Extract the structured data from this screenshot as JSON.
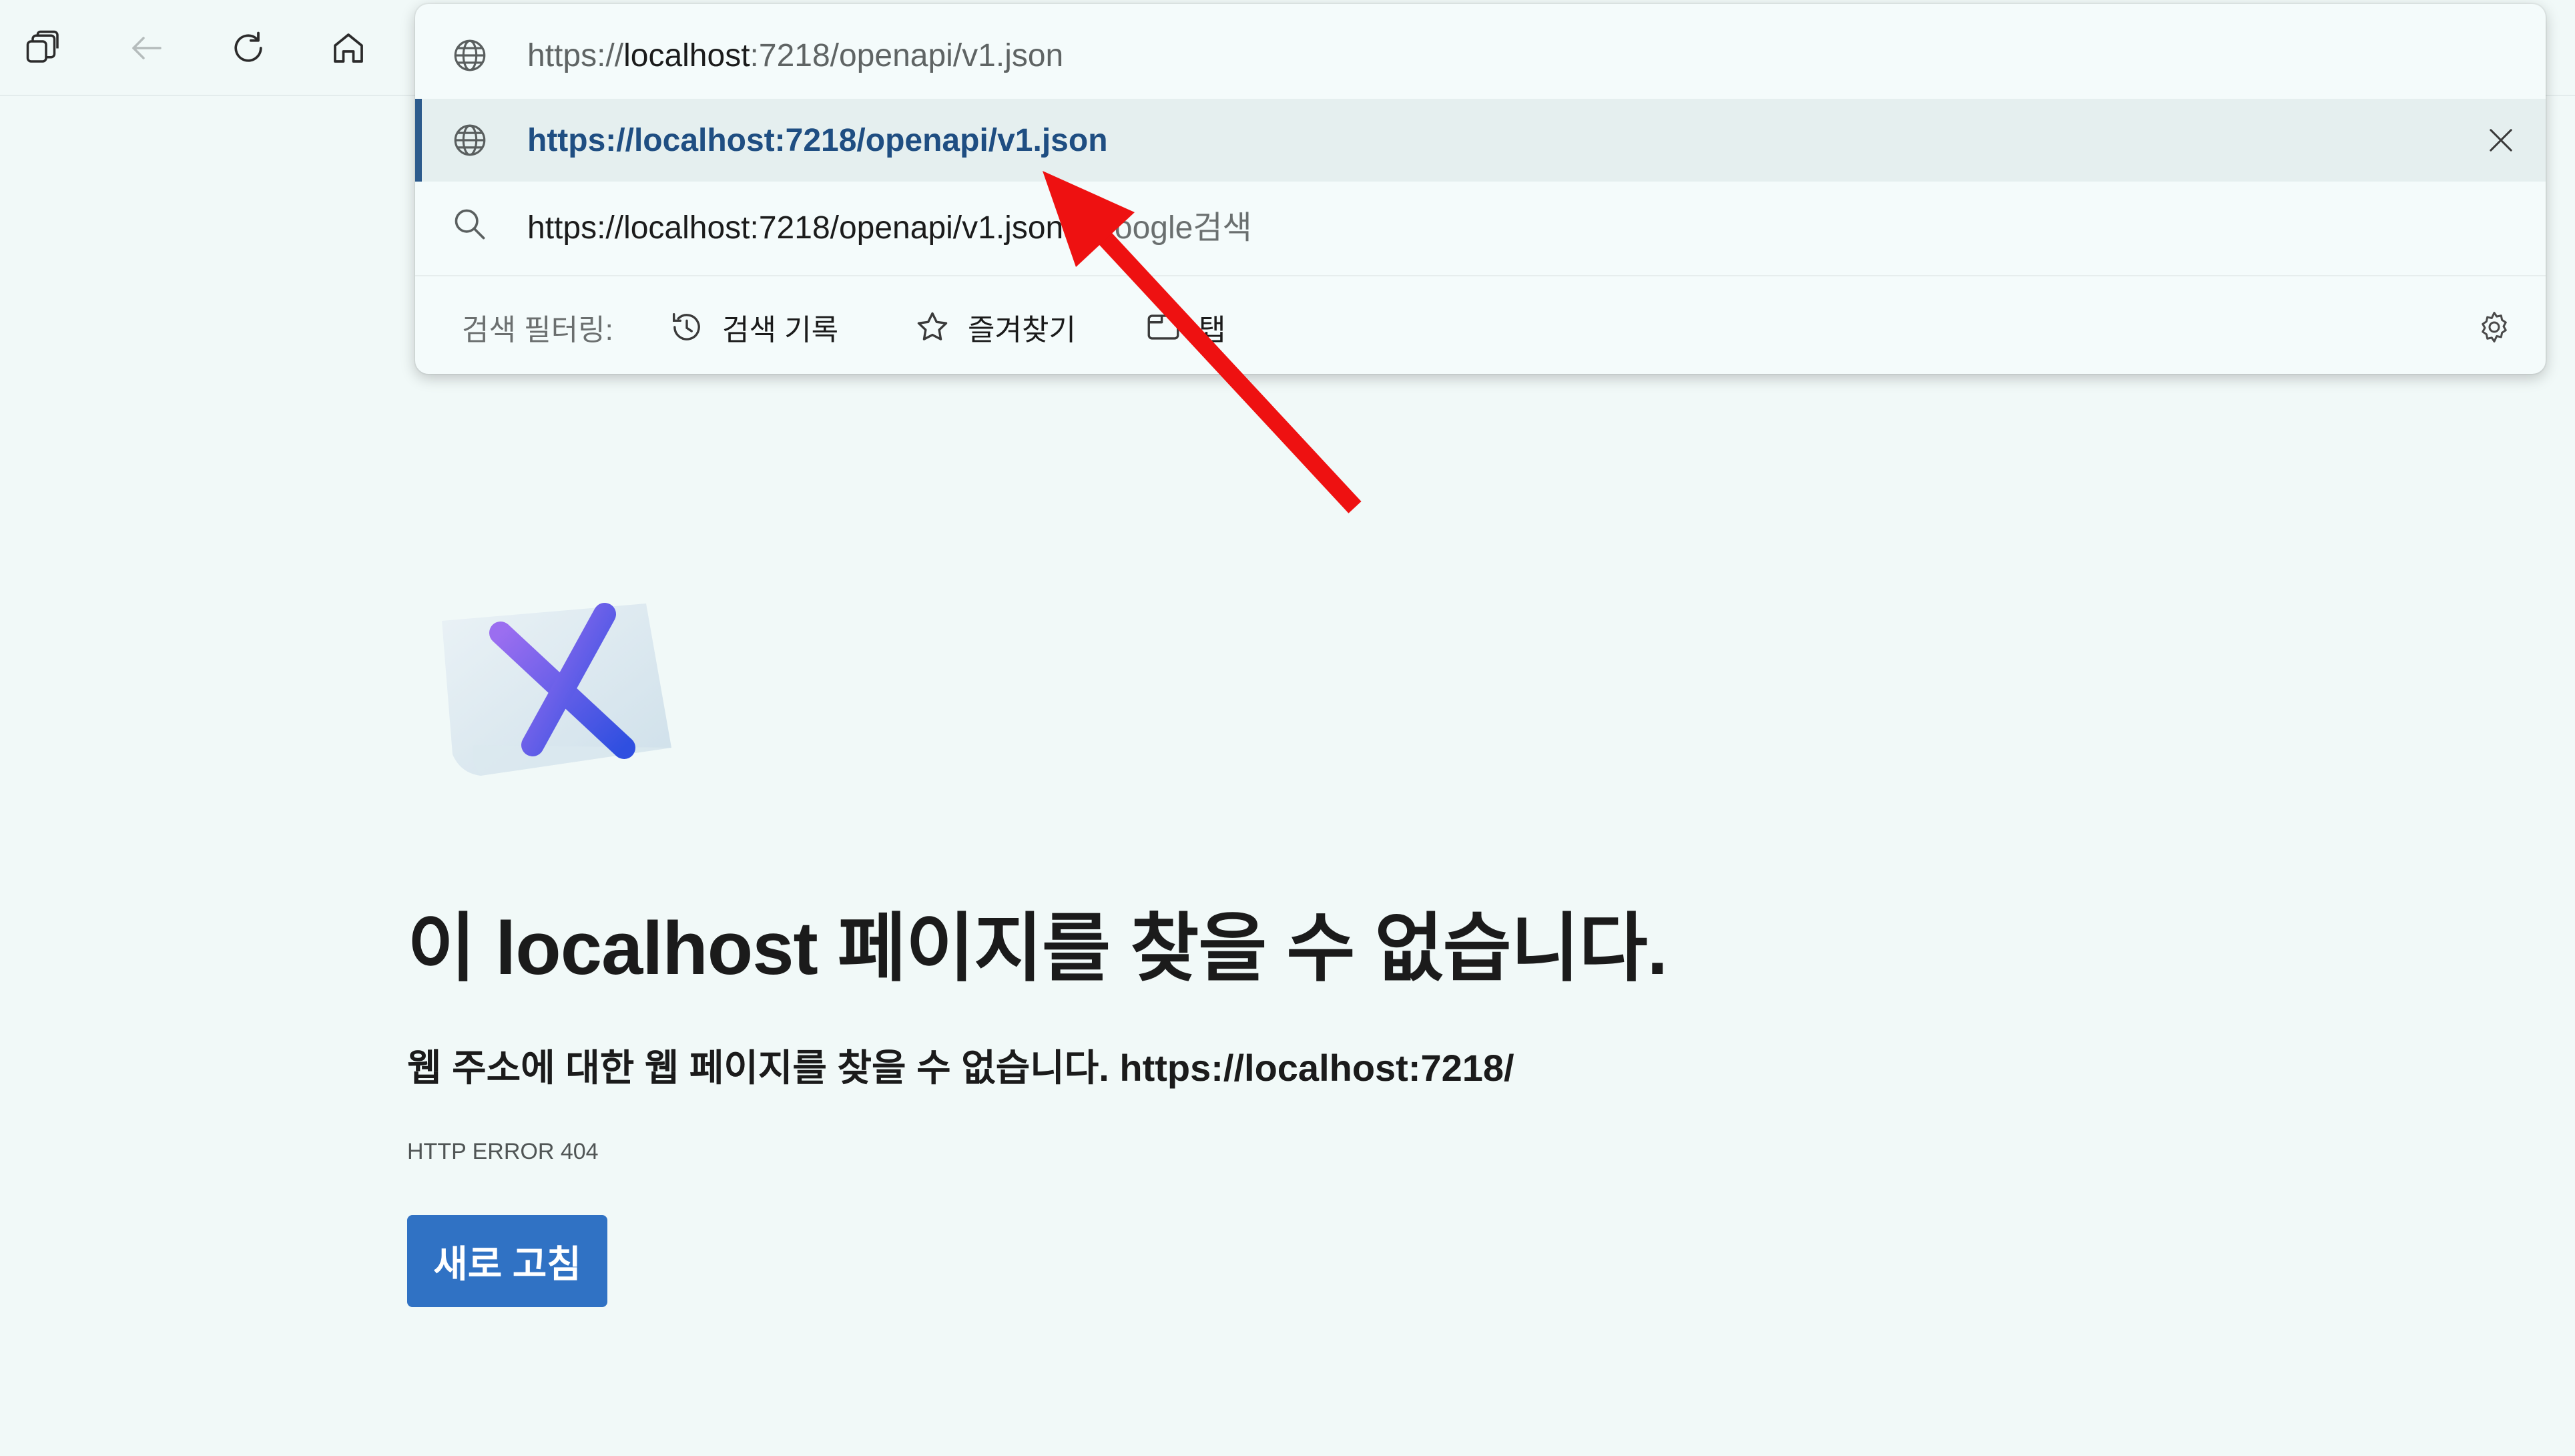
{
  "toolbar": {
    "buttons": [
      {
        "name": "workspaces-icon"
      },
      {
        "name": "back-arrow-icon"
      },
      {
        "name": "refresh-icon"
      },
      {
        "name": "home-icon"
      }
    ]
  },
  "address_bar": {
    "input_prefix": "https://",
    "input_host": "localhost",
    "input_suffix": ":7218/openapi/v1.json"
  },
  "suggestions": {
    "selected_url": "https://localhost:7218/openapi/v1.json",
    "search_query": "https://localhost:7218/openapi/v1.json",
    "search_suffix": "- Google검색"
  },
  "filter_bar": {
    "label": "검색 필터링:",
    "chips": [
      {
        "icon": "history-icon",
        "label": "검색 기록"
      },
      {
        "icon": "star-icon",
        "label": "즐겨찾기"
      },
      {
        "icon": "tab-icon",
        "label": "탭"
      }
    ]
  },
  "error_page": {
    "title": "이 localhost 페이지를 찾을 수 없습니다.",
    "description": "웹 주소에 대한 웹 페이지를 찾을 수 없습니다. https://localhost:7218/",
    "error_code": "HTTP ERROR 404",
    "reload_label": "새로 고침"
  },
  "colors": {
    "page_background": "#f1f9f8",
    "selected_url": "#1f4e82",
    "reload_button": "#3072c4",
    "annotation_arrow": "#ee1111"
  }
}
